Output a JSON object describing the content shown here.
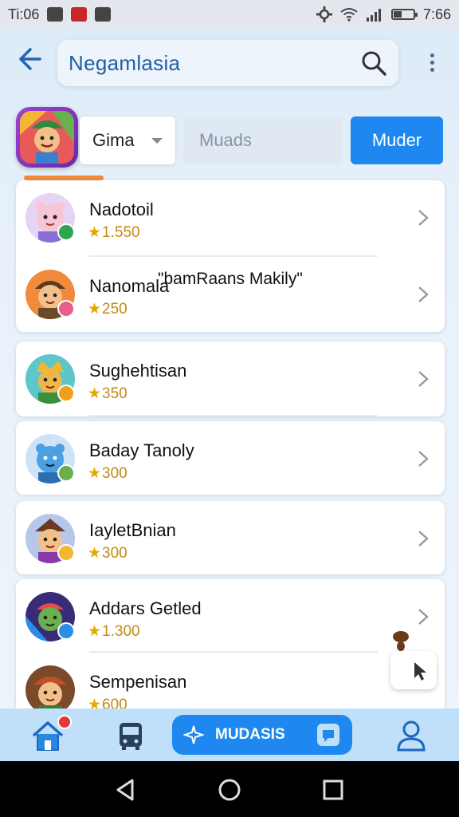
{
  "status_bar": {
    "left_text": "Ti:06",
    "time": "7:66"
  },
  "search": {
    "value": "Negamlasia"
  },
  "filters": {
    "dropdown_value": "Gima",
    "input_placeholder": "Muads",
    "button_label": "Muder"
  },
  "list": [
    {
      "name": "Nadotoil",
      "score": "1.550",
      "badge_color": "#2ea44f"
    },
    {
      "name": "Nanomala",
      "score": "250",
      "badge_color": "#e85d8a"
    },
    {
      "name": "Sughehtisan",
      "score": "350",
      "badge_color": "#f0a020"
    },
    {
      "name": "Baday Tanoly",
      "score": "300",
      "badge_color": "#6ab04c"
    },
    {
      "name": "IayletBnian",
      "score": "300",
      "badge_color": "#f2b632"
    },
    {
      "name": "Addars Getled",
      "score": "1.300",
      "badge_color": "#2a8de8"
    },
    {
      "name": "Sempenisan",
      "score": "600",
      "badge_color": "#2a8de8"
    }
  ],
  "overlay_text": "\"bamRaans Makily\"",
  "bottom_nav": {
    "center_label": "MUDASIS"
  },
  "colors": {
    "accent": "#1e88f0",
    "nav_bg": "#bfe0f8"
  }
}
